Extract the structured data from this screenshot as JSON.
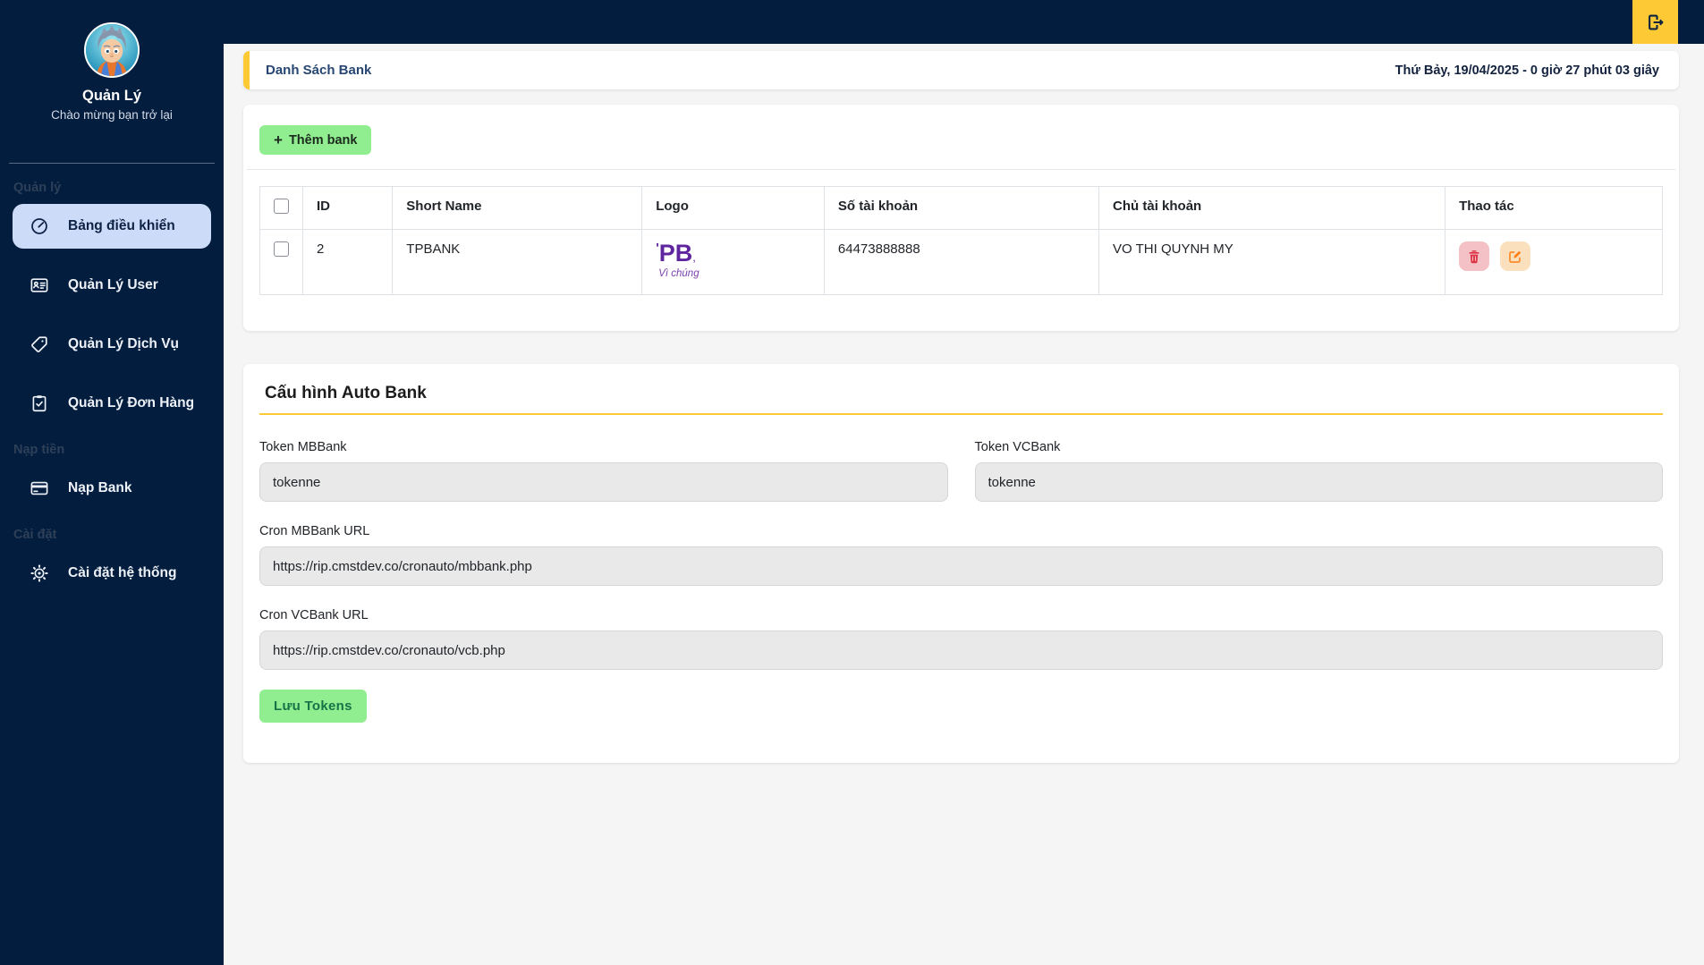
{
  "topbar": {
    "logout": "logout"
  },
  "sidebar": {
    "title": "Quản Lý",
    "subtitle": "Chào mừng bạn trở lại",
    "section_labels": [
      "Quản lý",
      "Nạp tiền",
      "Cài đặt"
    ],
    "items": [
      {
        "label": "Bảng điều khiển",
        "icon": "speedometer",
        "active": true
      },
      {
        "label": "Quản Lý User",
        "icon": "id-card",
        "active": false
      },
      {
        "label": "Quản Lý Dịch Vụ",
        "icon": "tag",
        "active": false
      },
      {
        "label": "Quản Lý Đơn Hàng",
        "icon": "clipboard-check",
        "active": false
      },
      {
        "label": "Nạp Bank",
        "icon": "credit-card",
        "active": false
      },
      {
        "label": "Cài đặt hệ thống",
        "icon": "gear",
        "active": false
      }
    ]
  },
  "header": {
    "title": "Danh Sách Bank",
    "datetime": "Thứ Bảy, 19/04/2025 - 0 giờ 27 phút 03 giây"
  },
  "bank_table": {
    "add_button": "Thêm bank",
    "add_plus": "+",
    "columns": [
      "ID",
      "Short Name",
      "Logo",
      "Số tài khoản",
      "Chủ tài khoản",
      "Thao tác"
    ],
    "row": {
      "id": "2",
      "short_name": "TPBANK",
      "logo": {
        "mark": "'",
        "text": "PB",
        "tail": ",",
        "tagline": "Vì chúng"
      },
      "account_number": "64473888888",
      "account_holder": "VO THI QUYNH MY"
    }
  },
  "auto_bank": {
    "title": "Cấu hình Auto Bank",
    "token_mbbank_label": "Token MBBank",
    "token_mbbank_value": "tokenne",
    "token_vcbank_label": "Token VCBank",
    "token_vcbank_value": "tokenne",
    "cron_mbbank_label": "Cron MBBank URL",
    "cron_mbbank_value": "https://rip.cmstdev.co/cronauto/mbbank.php",
    "cron_vcbank_label": "Cron VCBank URL",
    "cron_vcbank_value": "https://rip.cmstdev.co/cronauto/vcb.php",
    "save_button": "Lưu Tokens"
  },
  "colors": {
    "navy": "#031d3e",
    "yellow": "#fdca35",
    "green": "#90ee90",
    "active_item_bg": "#ccdcf8",
    "logo_purple": "#5f259f",
    "delete_red": "#dc3545",
    "edit_orange": "#fd7e14"
  }
}
